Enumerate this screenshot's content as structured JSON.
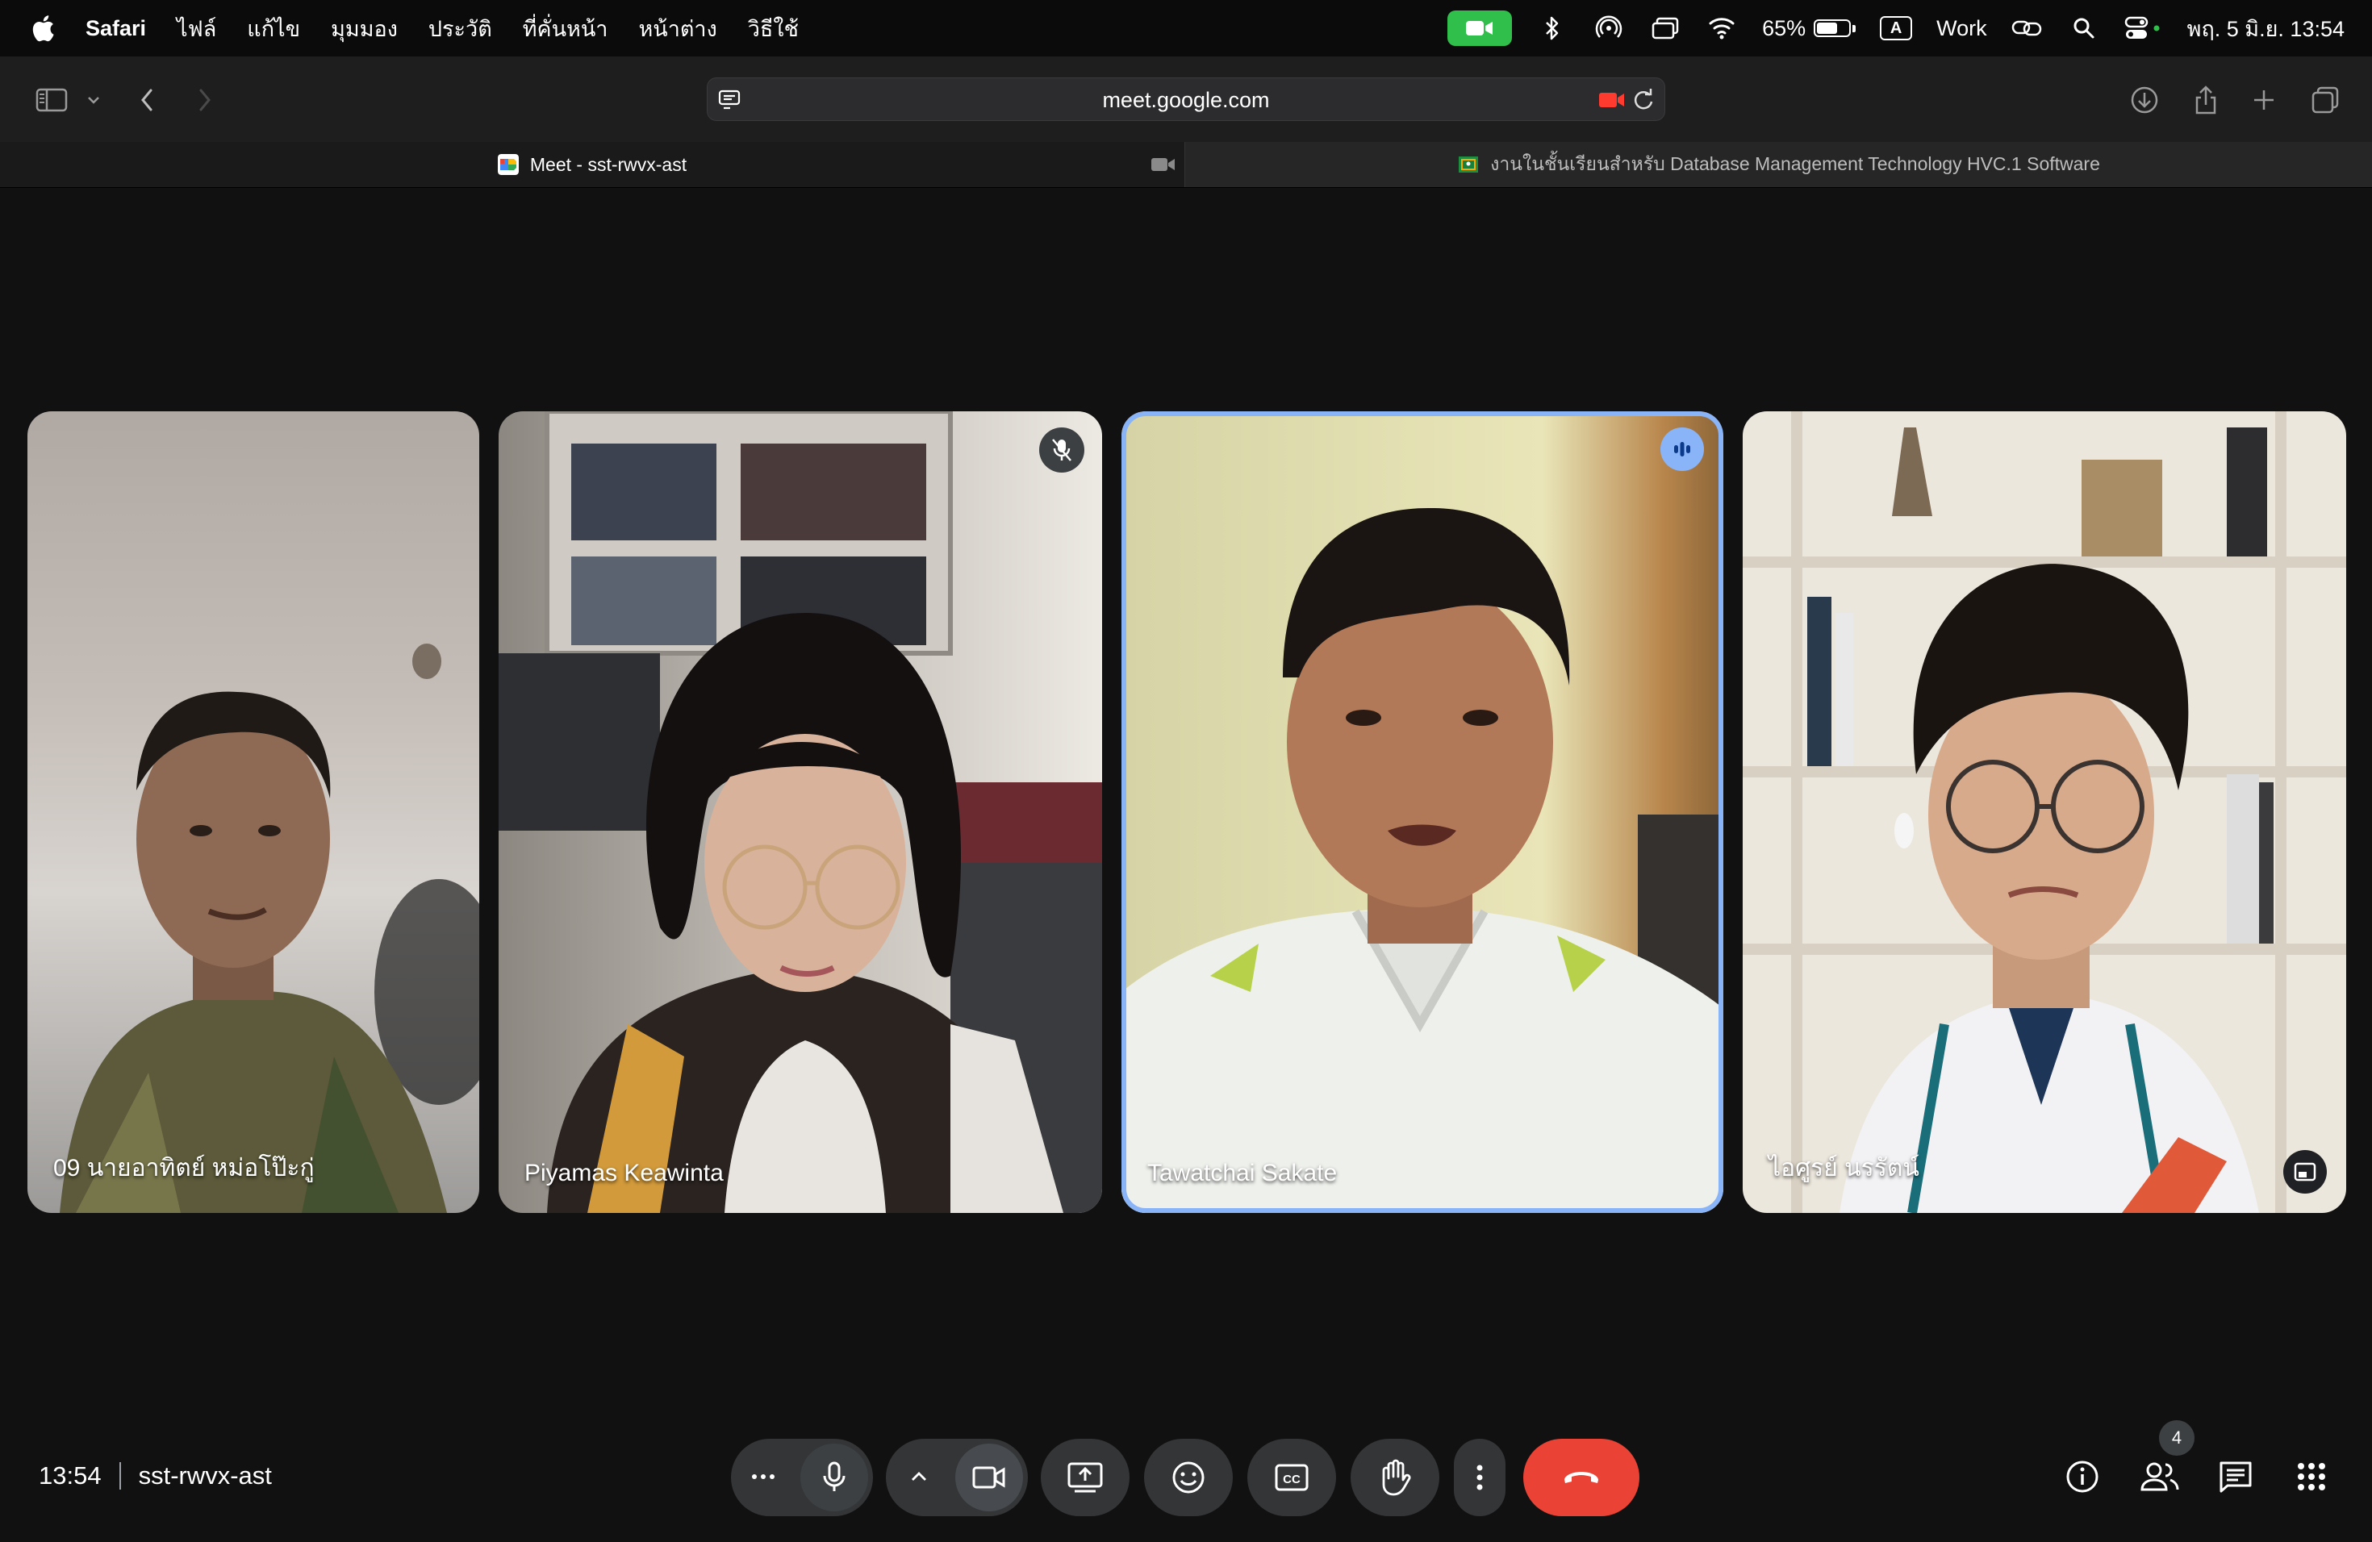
{
  "menubar": {
    "app": "Safari",
    "menus": [
      "ไฟล์",
      "แก้ไข",
      "มุมมอง",
      "ประวัติ",
      "ที่คั่นหน้า",
      "หน้าต่าง",
      "วิธีใช้"
    ],
    "battery_percent": "65%",
    "battery_level": 0.65,
    "input_source": "A",
    "focus_mode": "Work",
    "datetime": "พฤ. 5 มิ.ย.  13:54"
  },
  "safari": {
    "url": "meet.google.com",
    "tabs": [
      {
        "title": "Meet - sst-rwvx-ast",
        "active": true
      },
      {
        "title": "งานในชั้นเรียนสำหรับ Database Management Technology HVC.1 Software",
        "active": false
      }
    ]
  },
  "meet": {
    "participants": [
      {
        "name": "09 นายอาทิตย์ หม่อโป๊ะกู่",
        "muted": false,
        "speaking": false
      },
      {
        "name": "Piyamas Keawinta",
        "muted": true,
        "speaking": false
      },
      {
        "name": "Tawatchai Sakate",
        "muted": false,
        "speaking": true
      },
      {
        "name": "ไอศูรย์ นรรัตน์",
        "muted": false,
        "speaking": false
      }
    ],
    "time": "13:54",
    "meeting_code": "sst-rwvx-ast",
    "people_count": "4"
  },
  "colors": {
    "speaking_ring": "#8ab4f8",
    "hangup": "#ea4335",
    "facetime_indicator": "#2fbf4a",
    "recording_indicator": "#ff3b30"
  },
  "icons": [
    "apple-icon",
    "facetime-video-icon",
    "bluetooth-icon",
    "airdrop-icon",
    "screen-mirroring-icon",
    "wifi-icon",
    "battery-icon",
    "spotlight-search-icon",
    "control-center-icon",
    "sidebar-icon",
    "back-icon",
    "forward-icon",
    "download-icon",
    "share-icon",
    "new-tab-icon",
    "tab-overview-icon",
    "mic-off-icon",
    "audio-level-icon",
    "pip-icon",
    "more-options-icon",
    "microphone-icon",
    "camera-icon",
    "present-icon",
    "emoji-icon",
    "captions-icon",
    "raise-hand-icon",
    "hangup-icon",
    "info-icon",
    "people-icon",
    "chat-icon",
    "activities-icon"
  ]
}
